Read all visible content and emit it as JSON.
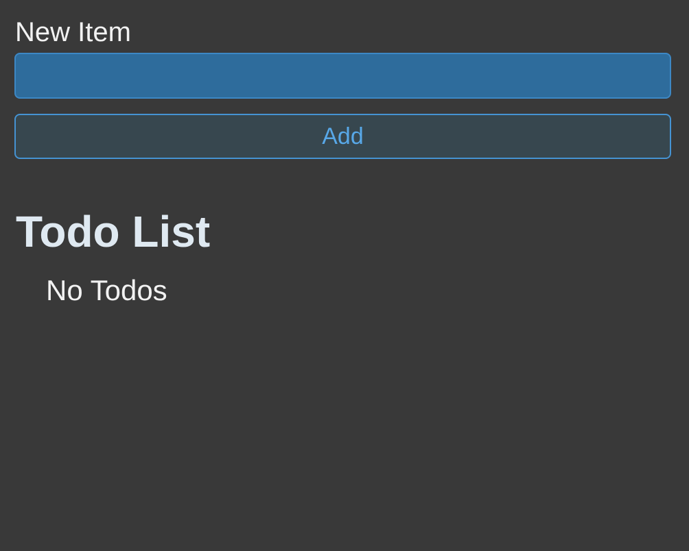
{
  "form": {
    "label": "New Item",
    "input_value": "",
    "input_placeholder": "",
    "add_button_label": "Add"
  },
  "todo": {
    "title": "Todo List",
    "empty_message": "No Todos"
  },
  "colors": {
    "background": "#393939",
    "input_fill": "#2e6c9c",
    "accent": "#4593d3",
    "button_text": "#58a8e8"
  }
}
